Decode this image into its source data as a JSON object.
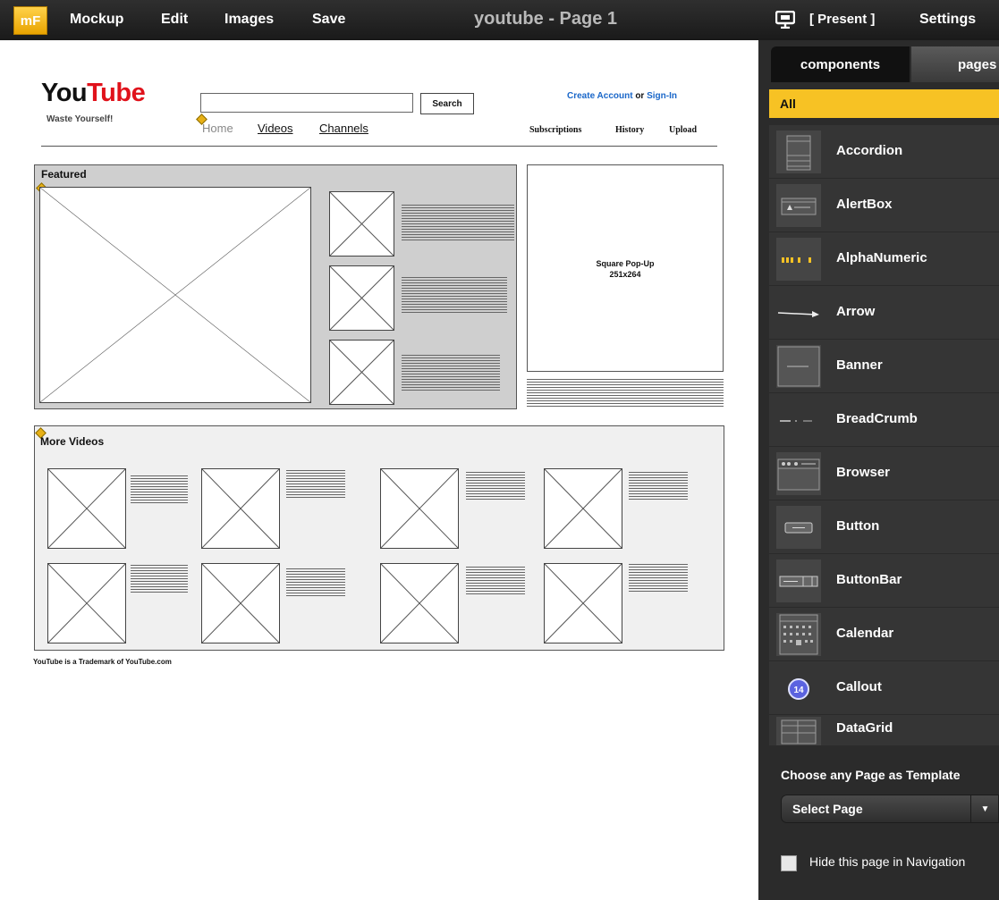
{
  "topbar": {
    "logo": "mF",
    "menu": [
      "Mockup",
      "Edit",
      "Images",
      "Save"
    ],
    "title": "youtube - Page 1",
    "present_label": "[ Present ]",
    "settings_label": "Settings"
  },
  "wireframe": {
    "logo_you": "You",
    "logo_tube": "Tube",
    "slogan": "Waste Yourself!",
    "search_button": "Search",
    "create_account": "Create Account",
    "or_text": " or ",
    "sign_in": "Sign-In",
    "nav": [
      "Home",
      "Videos",
      "Channels"
    ],
    "right_nav": [
      "Subscriptions",
      "History",
      "Upload"
    ],
    "featured_title": "Featured",
    "popup_line1": "Square Pop-Up",
    "popup_line2": "251x264",
    "more_videos_title": "More Videos",
    "footer": "YouTube is a Trademark of YouTube.com"
  },
  "sidebar": {
    "tabs": [
      "components",
      "pages"
    ],
    "filter": "All",
    "components": [
      "Accordion",
      "AlertBox",
      "AlphaNumeric",
      "Arrow",
      "Banner",
      "BreadCrumb",
      "Browser",
      "Button",
      "ButtonBar",
      "Calendar",
      "Callout",
      "DataGrid"
    ],
    "template_label": "Choose any Page as Template",
    "select_page": "Select Page",
    "hide_label": "Hide this page in Navigation"
  },
  "colors": {
    "accent": "#f7c224",
    "topbar": "#222222",
    "panel": "#2b2b2b",
    "youtube_red": "#e0121b",
    "link_blue": "#1a67c9"
  }
}
